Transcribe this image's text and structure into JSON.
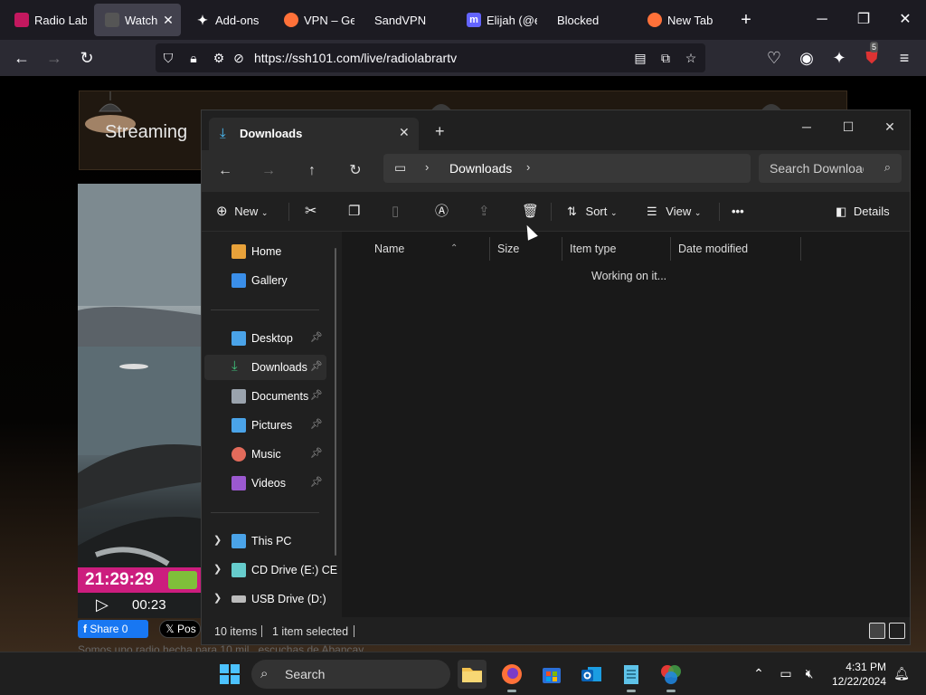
{
  "browser": {
    "tabs": [
      {
        "title": "Radio Labr",
        "favicon_color": "#c3185f",
        "active": false
      },
      {
        "title": "Watch | ",
        "favicon_color": "#555555",
        "active": true
      },
      {
        "title": "Add-ons f",
        "favicon_color": "#42414d",
        "active": false
      },
      {
        "title": "VPN – Get",
        "favicon_color": "#ff7139",
        "active": false
      },
      {
        "title": "SandVPN",
        "favicon_color": "",
        "active": false
      },
      {
        "title": "Elijah (@el",
        "favicon_color": "#6364ff",
        "active": false
      },
      {
        "title": "Blocked",
        "favicon_color": "",
        "active": false
      },
      {
        "title": "New Tab",
        "favicon_color": "#ff7139",
        "active": false
      }
    ],
    "new_tab_glyph": "+",
    "window_controls": {
      "minimize": "─",
      "maximize": "❐",
      "close": "✕"
    },
    "url": "https://ssh101.com/live/radiolabrartv",
    "extension_badge": "5"
  },
  "webpage": {
    "banner_title": "Streaming",
    "clock": "21:29:29",
    "elapsed": "00:23",
    "fb_share": "Share 0",
    "x_post": "Pos",
    "under_text": "Somos uno radio hecha para 10 mil...escuchas de Abancay"
  },
  "explorer": {
    "tab_title": "Downloads",
    "breadcrumb_folder": "Downloads",
    "search_placeholder": "Search Downloads",
    "commands": {
      "new": "New",
      "sort": "Sort",
      "view": "View",
      "more": "•••",
      "details": "Details"
    },
    "nav": {
      "quick": [
        {
          "label": "Home",
          "icon": "home-icon",
          "color": "#e8a23a"
        },
        {
          "label": "Gallery",
          "icon": "gallery-icon",
          "color": "#3a8ee8"
        }
      ],
      "pinned": [
        {
          "label": "Desktop",
          "icon": "desktop-icon",
          "color": "#4aa3e8"
        },
        {
          "label": "Downloads",
          "icon": "downloads-icon",
          "color": "#3fc07a",
          "selected": true
        },
        {
          "label": "Documents",
          "icon": "documents-icon",
          "color": "#9aa3ad"
        },
        {
          "label": "Pictures",
          "icon": "pictures-icon",
          "color": "#4aa3e8"
        },
        {
          "label": "Music",
          "icon": "music-icon",
          "color": "#e36b5b"
        },
        {
          "label": "Videos",
          "icon": "videos-icon",
          "color": "#9b59d0"
        }
      ],
      "drives": [
        {
          "label": "This PC",
          "icon": "this-pc-icon",
          "color": "#4aa3e8"
        },
        {
          "label": "CD Drive (E:) CE",
          "icon": "cd-drive-icon",
          "color": "#6cc"
        },
        {
          "label": "USB Drive (D:)",
          "icon": "usb-drive-icon",
          "color": "#bbb"
        }
      ]
    },
    "columns": [
      "Name",
      "Size",
      "Item type",
      "Date modified"
    ],
    "status_message": "Working on it...",
    "status_items": "10 items",
    "status_selected": "1 item selected"
  },
  "taskbar": {
    "search_label": "Search",
    "time": "4:31 PM",
    "date": "12/22/2024"
  }
}
